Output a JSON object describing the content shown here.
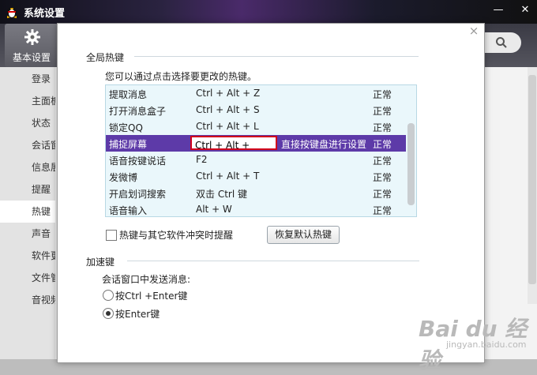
{
  "window": {
    "title": "系统设置",
    "minimize_glyph": "—",
    "close_glyph": "✕",
    "top_tab_label": "基本设置"
  },
  "sidebar": {
    "items": [
      {
        "label": "登录"
      },
      {
        "label": "主面板"
      },
      {
        "label": "状态"
      },
      {
        "label": "会话窗"
      },
      {
        "label": "信息展"
      },
      {
        "label": "提醒"
      },
      {
        "label": "热键",
        "active": true
      },
      {
        "label": "声音"
      },
      {
        "label": "软件更"
      },
      {
        "label": "文件管"
      },
      {
        "label": "音视频"
      }
    ]
  },
  "dialog": {
    "close_glyph": "×",
    "hotkeys_section_title": "全局热键",
    "hotkeys_hint": "您可以通过点击选择要更改的热键。",
    "hotkeys": [
      {
        "name": "提取消息",
        "key": "Ctrl + Alt + Z",
        "status": "正常"
      },
      {
        "name": "打开消息盒子",
        "key": "Ctrl + Alt + S",
        "status": "正常"
      },
      {
        "name": "锁定QQ",
        "key": "Ctrl + Alt + L",
        "status": "正常"
      },
      {
        "name": "捕捉屏幕",
        "key": "Ctrl + Alt +",
        "status": "正常",
        "instruction": "直接按键盘进行设置",
        "selected": true
      },
      {
        "name": "语音按键说话",
        "key": "F2",
        "status": "正常"
      },
      {
        "name": "发微博",
        "key": "Ctrl + Alt + T",
        "status": "正常"
      },
      {
        "name": "开启划词搜索",
        "key": "双击 Ctrl 键",
        "status": "正常"
      },
      {
        "name": "语音输入",
        "key": "Alt + W",
        "status": "正常"
      }
    ],
    "conflict_checkbox_label": "热键与其它软件冲突时提醒",
    "conflict_checked": false,
    "restore_button_label": "恢复默认热键",
    "accel_section_title": "加速键",
    "send_label": "会话窗口中发送消息:",
    "radio_options": [
      {
        "label": "按Ctrl +Enter键",
        "checked": false
      },
      {
        "label": "按Enter键",
        "checked": true
      }
    ]
  },
  "watermark": {
    "text": "Bai du 经验",
    "sub": "jingyan.baidu.com"
  },
  "colors": {
    "selected_row": "#5d3aa8",
    "edit_border": "#d0001a",
    "list_bg": "#eaf7fb"
  }
}
